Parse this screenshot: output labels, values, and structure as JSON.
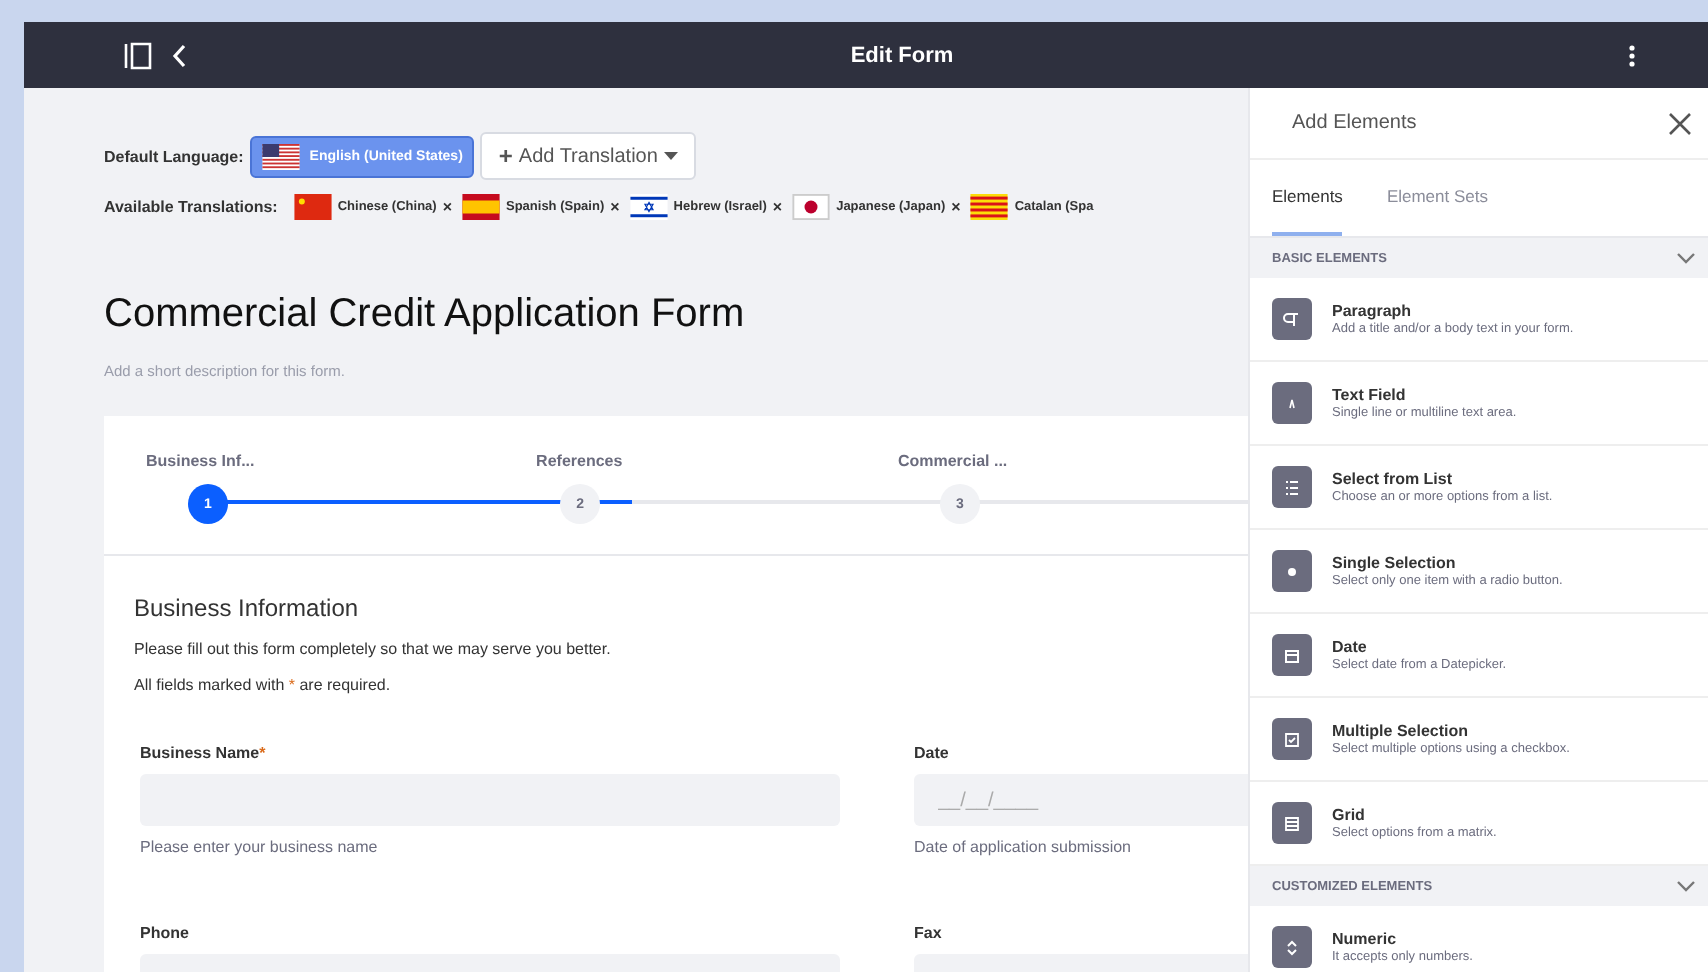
{
  "topbar": {
    "title": "Edit Form"
  },
  "default_language": {
    "label": "Default Language:",
    "value": "English (United States)",
    "kind": "us",
    "add_button": "Add Translation",
    "add_icon": "+"
  },
  "available_translations": {
    "label": "Available Translations:",
    "items": [
      {
        "name": "Chinese (China)",
        "kind": "cn",
        "remove": "×"
      },
      {
        "name": "Spanish (Spain)",
        "kind": "es",
        "remove": "×"
      },
      {
        "name": "Hebrew (Israel)",
        "kind": "il",
        "remove": "×"
      },
      {
        "name": "Japanese (Japan)",
        "kind": "jp",
        "remove": "×"
      },
      {
        "name": "Catalan (Spa",
        "kind": "ca"
      }
    ]
  },
  "form": {
    "title": "Commercial Credit Application Form",
    "description_placeholder": "Add a short description for this form.",
    "steps": [
      {
        "label": "Business Inf...",
        "number": "1",
        "selected": true
      },
      {
        "label": "References",
        "number": "2",
        "selected": false
      },
      {
        "label": "Commercial ...",
        "number": "3",
        "selected": false
      }
    ],
    "section_title": "Business Information",
    "intro": "Please fill out this form completely so that we may serve you better.",
    "required_note": "All fields marked with * are required.",
    "required_mark": "*",
    "fields": [
      {
        "label": "Business Name",
        "required": true,
        "help": "Please enter your business name"
      },
      {
        "label": "Date",
        "required": false,
        "placeholder": "__/__/____",
        "help": "Date of application submission"
      },
      {
        "label": "Phone",
        "required": false
      },
      {
        "label": "Fax",
        "required": false
      }
    ]
  },
  "panel": {
    "title": "Add Elements",
    "tabs": [
      {
        "label": "Elements",
        "selected": true
      },
      {
        "label": "Element Sets",
        "selected": false
      }
    ],
    "sections": [
      {
        "title": "BASIC ELEMENTS",
        "items": [
          {
            "kind": "paragraph",
            "name": "Paragraph",
            "description": "Add a title and/or a body text in your form."
          },
          {
            "kind": "text",
            "name": "Text Field",
            "description": "Single line or multiline text area."
          },
          {
            "kind": "list",
            "name": "Select from List",
            "description": "Choose an or more options from a list."
          },
          {
            "kind": "radio",
            "name": "Single Selection",
            "description": "Select only one item with a radio button."
          },
          {
            "kind": "date",
            "name": "Date",
            "description": "Select date from a Datepicker."
          },
          {
            "kind": "checkbox",
            "name": "Multiple Selection",
            "description": "Select multiple options using a checkbox."
          },
          {
            "kind": "grid",
            "name": "Grid",
            "description": "Select options from a matrix."
          }
        ]
      },
      {
        "title": "CUSTOMIZED ELEMENTS",
        "items": [
          {
            "kind": "numeric",
            "name": "Numeric",
            "description": "It accepts only numbers."
          }
        ]
      }
    ]
  }
}
